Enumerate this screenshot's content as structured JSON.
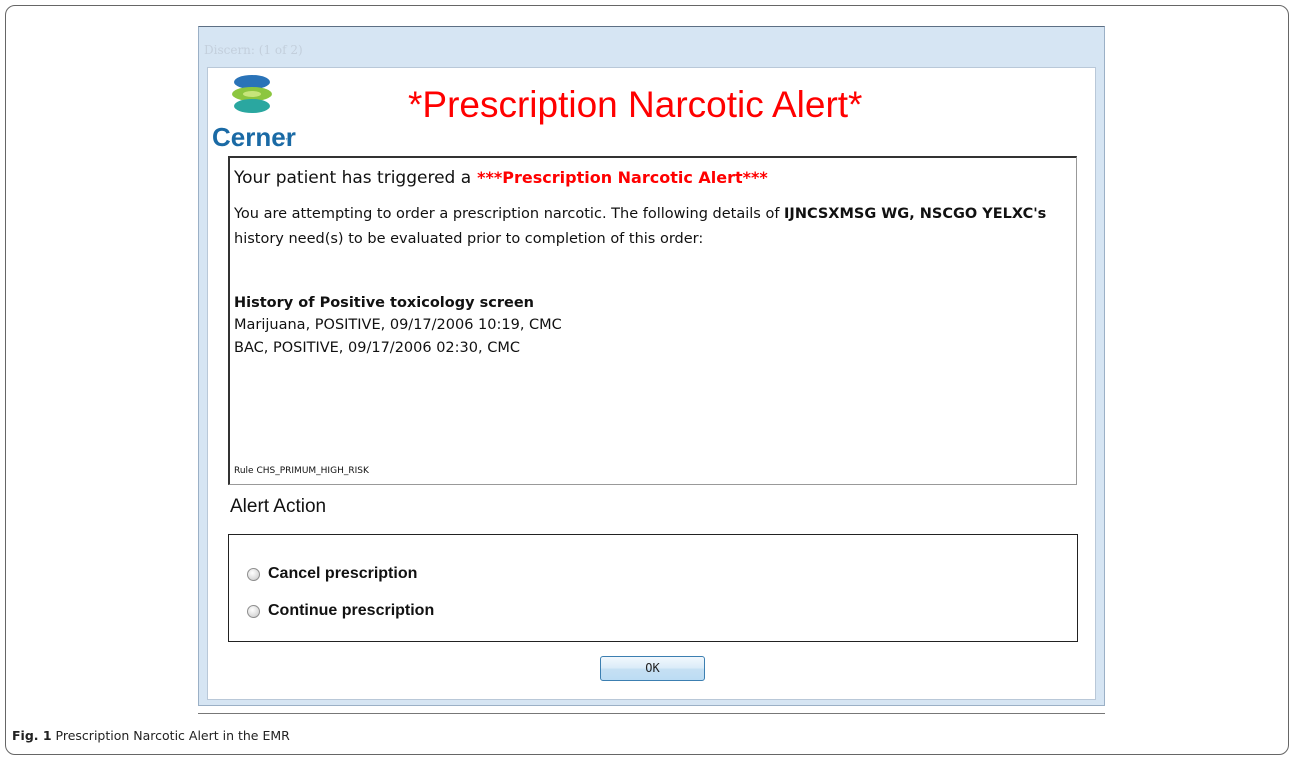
{
  "window": {
    "title": "Discern:  (1 of 2)"
  },
  "logo": {
    "text": "Cerner",
    "tm": "™"
  },
  "alert_title": "*Prescription Narcotic Alert*",
  "message": {
    "intro": "Your patient has triggered a",
    "intro_alert": "***Prescription Narcotic Alert***",
    "body_pre": "You are attempting to order a prescription narcotic. The following details of ",
    "patient_name": "IJNCSXMSG WG, NSCGO YELXC's",
    "body_post": " history need(s) to be evaluated prior to completion of this order:",
    "history_heading": "History of Positive toxicology screen",
    "history_items": [
      "Marijuana, POSITIVE, 09/17/2006 10:19, CMC",
      "BAC, POSITIVE, 09/17/2006 02:30, CMC"
    ],
    "rule": "Rule CHS_PRIMUM_HIGH_RISK"
  },
  "alert_action": {
    "label": "Alert Action",
    "options": [
      "Cancel prescription",
      "Continue prescription"
    ]
  },
  "ok_label": "OK",
  "caption": {
    "fig": "Fig. 1",
    "text": " Prescription Narcotic Alert in the EMR"
  },
  "colors": {
    "alert_red": "#ff0000",
    "cerner_blue": "#1a6aa5",
    "window_frame": "#d6e5f3"
  }
}
